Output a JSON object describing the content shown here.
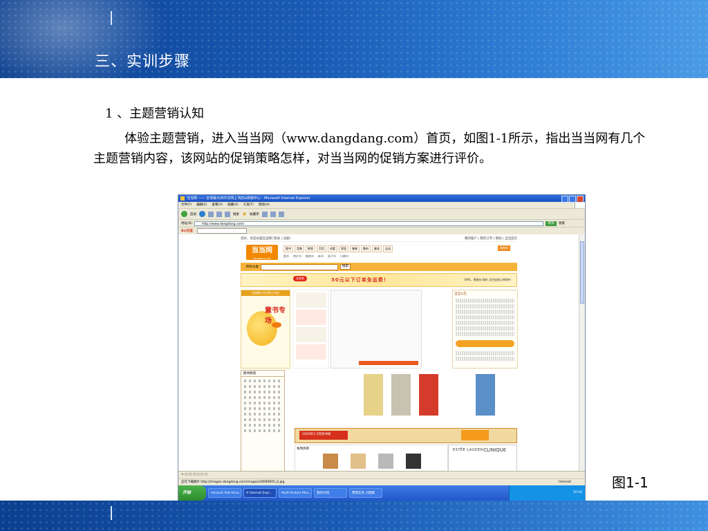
{
  "slide": {
    "title": "三、实训步骤",
    "subheading": "1 、主题营销认知",
    "paragraph": "体验主题营销，进入当当网（www.dangdang.com）首页，如图1-1所示，指出当当网有几个主题营销内容，该网站的促销策略怎样，对当当网的促销方案进行评价。",
    "figure_caption": "图1-1"
  },
  "browser": {
    "window_title": "当当网 —— 全球最大的中文网上书店&购物中心 - Microsoft Internet Explorer",
    "menu": [
      "文件(F)",
      "编辑(E)",
      "查看(V)",
      "收藏(A)",
      "工具(T)",
      "帮助(H)"
    ],
    "toolbar": {
      "back": "后退",
      "search": "搜索",
      "favorites": "收藏夹"
    },
    "address_label": "地址(D)",
    "address": "http://www.dangdang.com/",
    "go": "转到",
    "links_label": "链接",
    "status_text": "正在下载图片 http://images.dangdang.com/images/20090605_b.jpg",
    "zone": "Internet"
  },
  "site": {
    "top_welcome": "您好，欢迎光临当当网 [登录 | 注册]",
    "top_links": "我的账户 | 我的订单 | 帮助 | 当当首页",
    "logo": "当当网",
    "logo_sub": "dangdang.com",
    "nav": [
      "图书",
      "音像",
      "影视",
      "百货",
      "母婴",
      "家居",
      "服装",
      "数码",
      "美妆",
      "运动"
    ],
    "nav2": [
      "图书",
      "特价书",
      "畅销书",
      "新书",
      "电子书",
      "口碑书"
    ],
    "cart": "购物车",
    "search_scope": "所有分类",
    "search_btn": "搜索",
    "banner_text": "30元以下订单免运费！",
    "banner_tag": "全场免",
    "banner_note": "EMS、港澳台/海外 北京加急订单除外",
    "promo_head": "全球最大中文网上书店",
    "promo_tag": "童书专场",
    "notice_head": "当当公告",
    "category_head": "图书频道",
    "recommend_head": "本周热荐",
    "promo_month": "2009年1-5月新书榜",
    "ad_brand1": "ESTĒE LAUDER",
    "ad_brand2": "CLINIQUE"
  },
  "taskbar": {
    "start": "开始",
    "items": [
      "Intranet Anti-Virus",
      "4 Internet Expl...",
      "Multi-Protect Mon...",
      "我的文档",
      "营销实务-习题集"
    ],
    "clock": "20:56"
  },
  "colors": {
    "header_blue": "#1a5cb6",
    "dangdang_orange": "#f18800",
    "banner_red": "#d42b1e"
  }
}
